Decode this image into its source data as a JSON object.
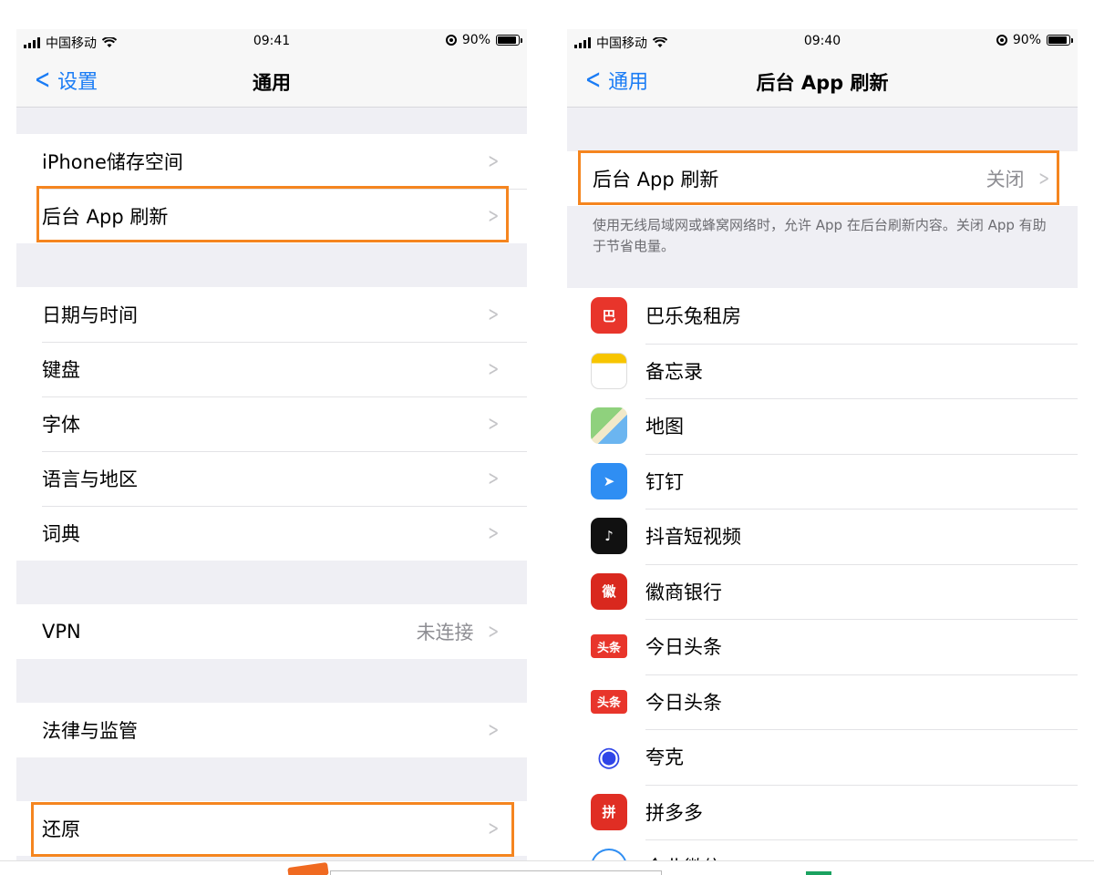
{
  "left": {
    "status": {
      "carrier": "中国移动",
      "time": "09:41",
      "battery": "90%"
    },
    "nav": {
      "back_label": "设置",
      "title": "通用"
    },
    "group1": [
      {
        "label": "iPhone储存空间"
      },
      {
        "label": "后台 App 刷新"
      }
    ],
    "group2": [
      {
        "label": "日期与时间"
      },
      {
        "label": "键盘"
      },
      {
        "label": "字体"
      },
      {
        "label": "语言与地区"
      },
      {
        "label": "词典"
      }
    ],
    "vpn": {
      "label": "VPN",
      "value": "未连接"
    },
    "legal": {
      "label": "法律与监管"
    },
    "reset": {
      "label": "还原"
    }
  },
  "right": {
    "status": {
      "carrier": "中国移动",
      "time": "09:40",
      "battery": "90%"
    },
    "nav": {
      "back_label": "通用",
      "title": "后台 App 刷新"
    },
    "main": {
      "label": "后台 App 刷新",
      "value": "关闭"
    },
    "note": "使用无线局域网或蜂窝网络时，允许 App 在后台刷新内容。关闭 App 有助于节省电量。",
    "apps": [
      {
        "name": "巴乐兔租房",
        "icon": "bale-rabbit-icon",
        "color": "#e8352b",
        "glyph": "巴"
      },
      {
        "name": "备忘录",
        "icon": "notes-icon",
        "color": "#f7f7f7",
        "glyph": ""
      },
      {
        "name": "地图",
        "icon": "maps-icon",
        "color": "#7cc46a",
        "glyph": ""
      },
      {
        "name": "钉钉",
        "icon": "dingtalk-icon",
        "color": "#2f8ef3",
        "glyph": "➤"
      },
      {
        "name": "抖音短视频",
        "icon": "douyin-icon",
        "color": "#111111",
        "glyph": "♪"
      },
      {
        "name": "徽商银行",
        "icon": "huishang-bank-icon",
        "color": "#d9281e",
        "glyph": "徽"
      },
      {
        "name": "今日头条",
        "icon": "toutiao-icon",
        "color": "#e8352b",
        "glyph": "头条"
      },
      {
        "name": "今日头条",
        "icon": "toutiao-icon",
        "color": "#e8352b",
        "glyph": "头条"
      },
      {
        "name": "夸克",
        "icon": "quark-icon",
        "color": "#ffffff",
        "glyph": "◉"
      },
      {
        "name": "拼多多",
        "icon": "pinduoduo-icon",
        "color": "#e02e24",
        "glyph": "拼"
      },
      {
        "name": "企业微信",
        "icon": "wework-icon",
        "color": "#ffffff",
        "glyph": ""
      }
    ]
  },
  "colors": {
    "accent": "#1a7cf5",
    "highlight": "#f5851f"
  }
}
